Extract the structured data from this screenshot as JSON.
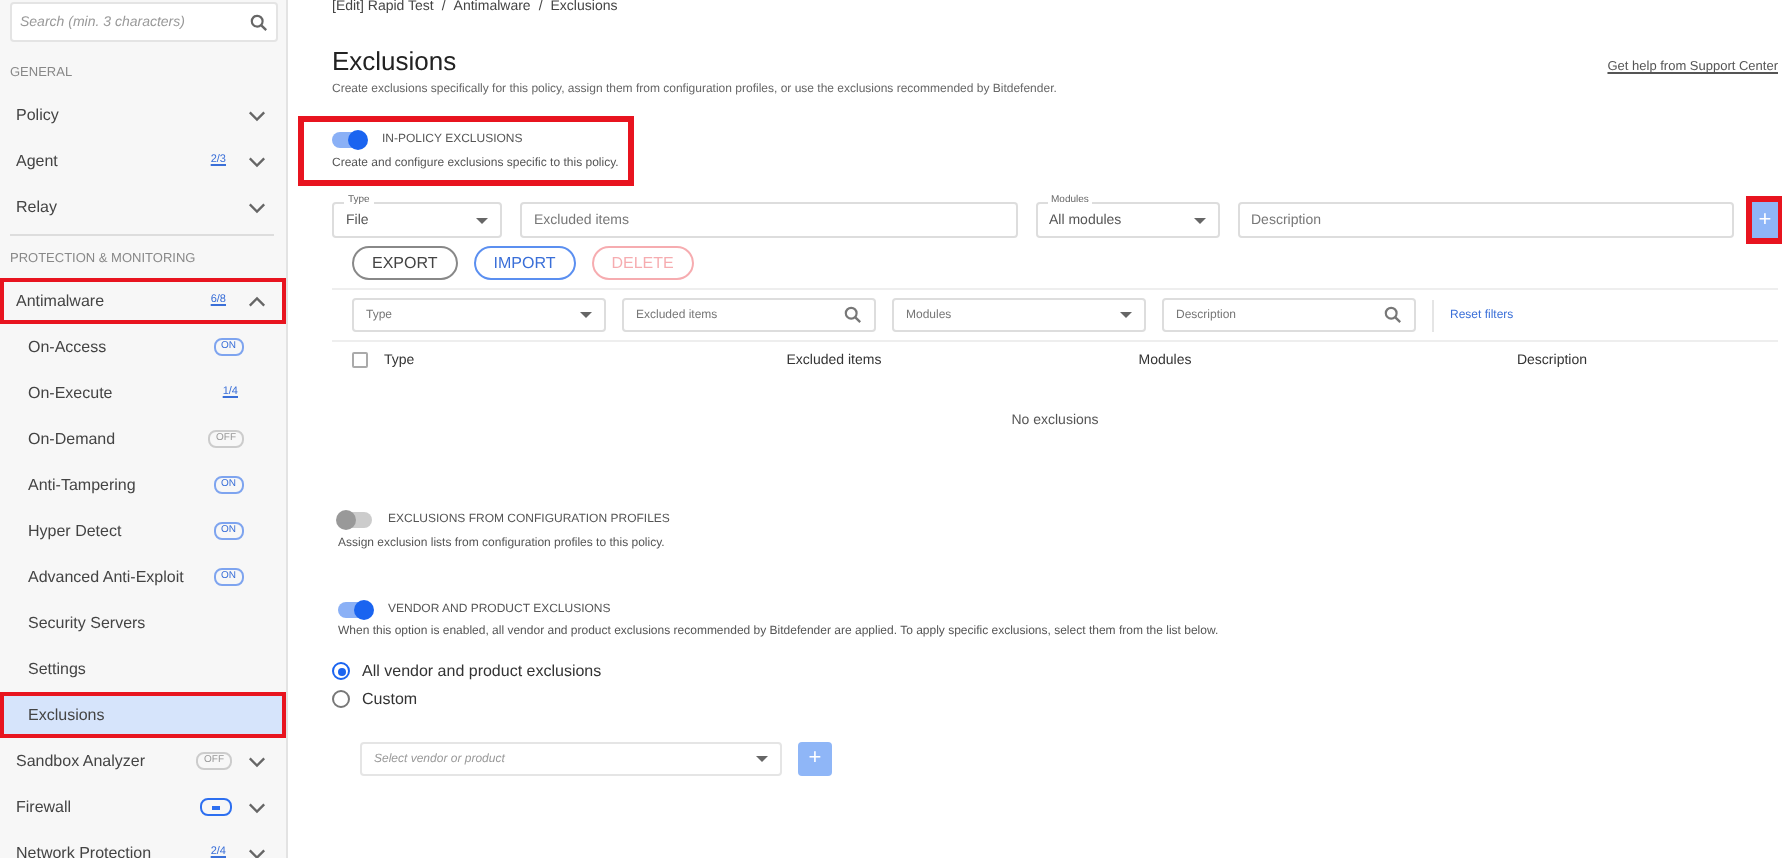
{
  "sidebar": {
    "search": {
      "placeholder": "Search (min. 3 characters)"
    },
    "sections": [
      {
        "title": "GENERAL",
        "items": [
          {
            "label": "Policy",
            "expanded": false,
            "selected": false,
            "highlighted": false
          },
          {
            "label": "Agent",
            "badge": {
              "kind": "count",
              "text": "2/3"
            },
            "expanded": false,
            "selected": false,
            "highlighted": false
          },
          {
            "label": "Relay",
            "expanded": false,
            "selected": false,
            "highlighted": false
          }
        ]
      },
      {
        "title": "PROTECTION & MONITORING",
        "items": [
          {
            "label": "Antimalware",
            "badge": {
              "kind": "count",
              "text": "6/8"
            },
            "expanded": true,
            "selected": false,
            "highlighted": true,
            "children": [
              {
                "label": "On-Access",
                "badge": {
                  "kind": "on",
                  "text": "ON"
                },
                "selected": false,
                "highlighted": false
              },
              {
                "label": "On-Execute",
                "badge": {
                  "kind": "count",
                  "text": "1/4"
                },
                "selected": false,
                "highlighted": false
              },
              {
                "label": "On-Demand",
                "badge": {
                  "kind": "off",
                  "text": "OFF"
                },
                "selected": false,
                "highlighted": false
              },
              {
                "label": "Anti-Tampering",
                "badge": {
                  "kind": "on",
                  "text": "ON"
                },
                "selected": false,
                "highlighted": false
              },
              {
                "label": "Hyper Detect",
                "badge": {
                  "kind": "on",
                  "text": "ON"
                },
                "selected": false,
                "highlighted": false
              },
              {
                "label": "Advanced Anti-Exploit",
                "badge": {
                  "kind": "on",
                  "text": "ON"
                },
                "selected": false,
                "highlighted": false
              },
              {
                "label": "Security Servers",
                "selected": false,
                "highlighted": false
              },
              {
                "label": "Settings",
                "selected": false,
                "highlighted": false
              },
              {
                "label": "Exclusions",
                "selected": true,
                "highlighted": true
              }
            ]
          },
          {
            "label": "Sandbox Analyzer",
            "badge": {
              "kind": "off",
              "text": "OFF"
            },
            "expanded": false,
            "selected": false,
            "highlighted": false
          },
          {
            "label": "Firewall",
            "badge": {
              "kind": "partial"
            },
            "expanded": false,
            "selected": false,
            "highlighted": false
          },
          {
            "label": "Network Protection",
            "badge": {
              "kind": "count",
              "text": "2/4"
            },
            "expanded": false,
            "selected": false,
            "highlighted": false
          }
        ]
      }
    ]
  },
  "breadcrumb": {
    "separator": "/",
    "items": [
      "[Edit] Rapid Test",
      "Antimalware",
      "Exclusions"
    ]
  },
  "title": "Exclusions",
  "description": "Create exclusions specifically for this policy, assign them from configuration profiles, or use the exclusions recommended by Bitdefender.",
  "help_link": "Get help from Support Center",
  "in_policy": {
    "on": true,
    "title": "IN-POLICY EXCLUSIONS",
    "description": "Create and configure exclusions specific to this policy.",
    "highlighted": true,
    "form": {
      "type": {
        "label": "Type",
        "value": "File"
      },
      "excluded_items": {
        "placeholder": "Excluded items"
      },
      "modules": {
        "label": "Modules",
        "value": "All modules"
      },
      "description": {
        "placeholder": "Description"
      },
      "add_button": {
        "text": "+",
        "highlighted": true,
        "disabled": true
      }
    },
    "buttons": [
      {
        "text": "EXPORT",
        "kind": "default",
        "disabled": false
      },
      {
        "text": "IMPORT",
        "kind": "primary",
        "disabled": false
      },
      {
        "text": "DELETE",
        "kind": "danger",
        "disabled": true
      }
    ],
    "filters": [
      {
        "kind": "select",
        "placeholder": "Type"
      },
      {
        "kind": "search",
        "placeholder": "Excluded items"
      },
      {
        "kind": "select",
        "placeholder": "Modules"
      },
      {
        "kind": "search",
        "placeholder": "Description"
      }
    ],
    "reset_filters": "Reset filters",
    "table": {
      "select_all_checked": false,
      "columns": [
        "Type",
        "Excluded items",
        "Modules",
        "Description"
      ],
      "empty_text": "No exclusions"
    }
  },
  "config_profiles": {
    "on": false,
    "title": "EXCLUSIONS FROM CONFIGURATION PROFILES",
    "description": "Assign exclusion lists from configuration profiles to this policy."
  },
  "vendor": {
    "on": true,
    "title": "VENDOR AND PRODUCT EXCLUSIONS",
    "description": "When this option is enabled, all vendor and product exclusions recommended by Bitdefender are applied. To apply specific exclusions, select them from the list below.",
    "options": [
      {
        "label": "All vendor and product exclusions",
        "selected": true
      },
      {
        "label": "Custom",
        "selected": false
      }
    ],
    "select": {
      "placeholder": "Select vendor or product"
    },
    "add_button": {
      "text": "+",
      "disabled": true
    }
  }
}
